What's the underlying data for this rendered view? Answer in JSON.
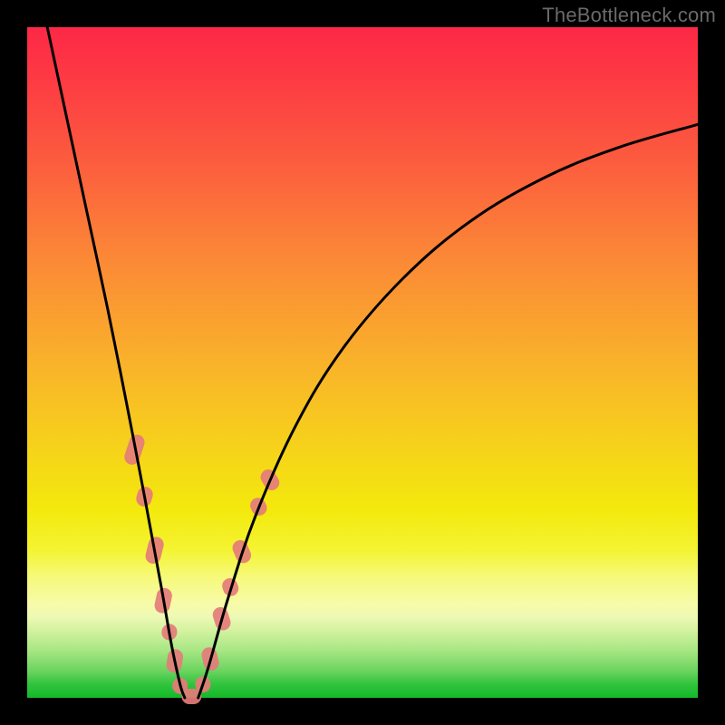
{
  "watermark": "TheBottleneck.com",
  "chart_data": {
    "type": "line",
    "title": "",
    "xlabel": "",
    "ylabel": "",
    "xlim": [
      0,
      1
    ],
    "ylim": [
      0,
      1
    ],
    "left_curve_note": "steep descending convex arc from top-left corner to valley floor",
    "right_curve_note": "ascending concave arc from valley floor to upper-right, flattening",
    "valley_x": 0.235,
    "valley_y": 0.0,
    "left_curve": [
      {
        "x": 0.03,
        "y": 1.0
      },
      {
        "x": 0.06,
        "y": 0.86
      },
      {
        "x": 0.09,
        "y": 0.72
      },
      {
        "x": 0.12,
        "y": 0.58
      },
      {
        "x": 0.15,
        "y": 0.43
      },
      {
        "x": 0.175,
        "y": 0.3
      },
      {
        "x": 0.2,
        "y": 0.165
      },
      {
        "x": 0.215,
        "y": 0.08
      },
      {
        "x": 0.228,
        "y": 0.02
      },
      {
        "x": 0.235,
        "y": 0.0
      }
    ],
    "right_curve": [
      {
        "x": 0.255,
        "y": 0.0
      },
      {
        "x": 0.27,
        "y": 0.045
      },
      {
        "x": 0.3,
        "y": 0.15
      },
      {
        "x": 0.34,
        "y": 0.27
      },
      {
        "x": 0.4,
        "y": 0.405
      },
      {
        "x": 0.47,
        "y": 0.52
      },
      {
        "x": 0.56,
        "y": 0.625
      },
      {
        "x": 0.66,
        "y": 0.71
      },
      {
        "x": 0.77,
        "y": 0.775
      },
      {
        "x": 0.88,
        "y": 0.82
      },
      {
        "x": 1.0,
        "y": 0.855
      }
    ],
    "markers_note": "salmon rounded-rect markers on both curve segments in lower quarter",
    "markers": [
      {
        "x": 0.16,
        "y": 0.37,
        "len": 34,
        "angle": -72
      },
      {
        "x": 0.175,
        "y": 0.3,
        "len": 22,
        "angle": -74
      },
      {
        "x": 0.19,
        "y": 0.22,
        "len": 30,
        "angle": -76
      },
      {
        "x": 0.203,
        "y": 0.145,
        "len": 28,
        "angle": -78
      },
      {
        "x": 0.212,
        "y": 0.098,
        "len": 18,
        "angle": -79
      },
      {
        "x": 0.22,
        "y": 0.055,
        "len": 26,
        "angle": -81
      },
      {
        "x": 0.228,
        "y": 0.018,
        "len": 18,
        "angle": -84
      },
      {
        "x": 0.245,
        "y": 0.002,
        "len": 22,
        "angle": 0
      },
      {
        "x": 0.262,
        "y": 0.02,
        "len": 18,
        "angle": 80
      },
      {
        "x": 0.273,
        "y": 0.058,
        "len": 26,
        "angle": 76
      },
      {
        "x": 0.29,
        "y": 0.118,
        "len": 26,
        "angle": 72
      },
      {
        "x": 0.303,
        "y": 0.165,
        "len": 20,
        "angle": 70
      },
      {
        "x": 0.32,
        "y": 0.218,
        "len": 26,
        "angle": 67
      },
      {
        "x": 0.345,
        "y": 0.285,
        "len": 20,
        "angle": 62
      },
      {
        "x": 0.362,
        "y": 0.325,
        "len": 24,
        "angle": 58
      }
    ],
    "colors": {
      "curve": "#000000",
      "marker_fill": "#e47c7a",
      "background_top": "#fd2846",
      "background_bottom": "#13b92a"
    }
  }
}
